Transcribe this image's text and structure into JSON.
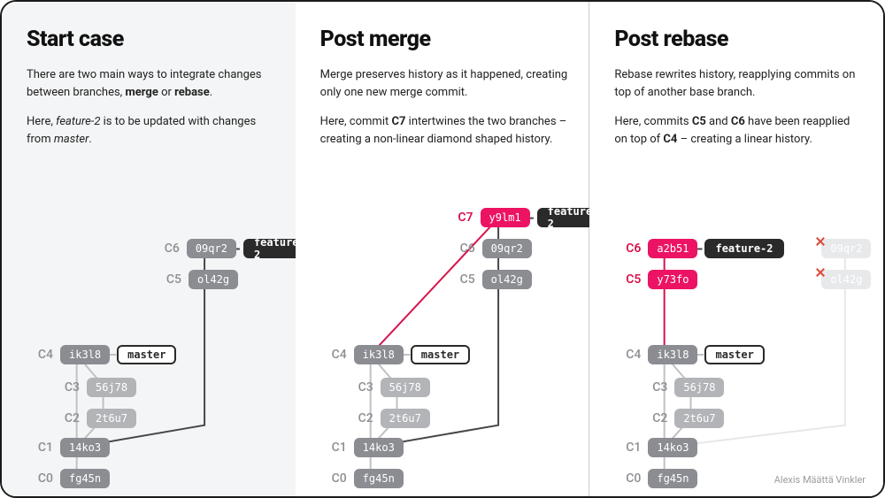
{
  "credit": "Alexis Määttä Vinkler",
  "colors": {
    "pink": "#ec1364",
    "pinkText": "#d6134c",
    "grey": "#8b8d92",
    "lightGrey": "#b2b4b8",
    "ghost": "#e8e9eb"
  },
  "branches": {
    "master": "master",
    "feature2": "feature-2"
  },
  "columns": {
    "start": {
      "title": "Start case",
      "p1_a": "There are two main ways to integrate changes between branches, ",
      "p1_b": "merge",
      "p1_c": " or ",
      "p1_d": "rebase",
      "p1_e": ".",
      "p2_a": "Here, ",
      "p2_b": "feature-2",
      "p2_c": " is to be updated with changes from ",
      "p2_d": "master",
      "p2_e": ".",
      "commits": {
        "c0": {
          "label": "C0",
          "hash": "fg45n"
        },
        "c1": {
          "label": "C1",
          "hash": "14ko3"
        },
        "c2": {
          "label": "C2",
          "hash": "2t6u7"
        },
        "c3": {
          "label": "C3",
          "hash": "56j78"
        },
        "c4": {
          "label": "C4",
          "hash": "ik3l8"
        },
        "c5": {
          "label": "C5",
          "hash": "ol42g"
        },
        "c6": {
          "label": "C6",
          "hash": "09qr2"
        }
      }
    },
    "merge": {
      "title": "Post merge",
      "p1": "Merge preserves history as it happened, creating only one new merge commit.",
      "p2_a": "Here, commit ",
      "p2_b": "C7",
      "p2_c": " intertwines the two branches – creating a non-linear diamond shaped history.",
      "commits": {
        "c0": {
          "label": "C0",
          "hash": "fg45n"
        },
        "c1": {
          "label": "C1",
          "hash": "14ko3"
        },
        "c2": {
          "label": "C2",
          "hash": "2t6u7"
        },
        "c3": {
          "label": "C3",
          "hash": "56j78"
        },
        "c4": {
          "label": "C4",
          "hash": "ik3l8"
        },
        "c5": {
          "label": "C5",
          "hash": "ol42g"
        },
        "c6": {
          "label": "C6",
          "hash": "09qr2"
        },
        "c7": {
          "label": "C7",
          "hash": "y9lm1"
        }
      }
    },
    "rebase": {
      "title": "Post rebase",
      "p1": "Rebase rewrites history, reapplying commits on top of another base branch.",
      "p2_a": "Here, commits ",
      "p2_b": "C5",
      "p2_c": " and ",
      "p2_d": "C6",
      "p2_e": " have been reapplied on top of ",
      "p2_f": "C4",
      "p2_g": " – creating a linear history.",
      "commits": {
        "c0": {
          "label": "C0",
          "hash": "fg45n"
        },
        "c1": {
          "label": "C1",
          "hash": "14ko3"
        },
        "c2": {
          "label": "C2",
          "hash": "2t6u7"
        },
        "c3": {
          "label": "C3",
          "hash": "56j78"
        },
        "c4": {
          "label": "C4",
          "hash": "ik3l8"
        },
        "c5": {
          "label": "C5",
          "hash": "y73fo"
        },
        "c6": {
          "label": "C6",
          "hash": "a2b51"
        },
        "g5": {
          "hash": "ol42g"
        },
        "g6": {
          "hash": "09qr2"
        }
      }
    }
  }
}
